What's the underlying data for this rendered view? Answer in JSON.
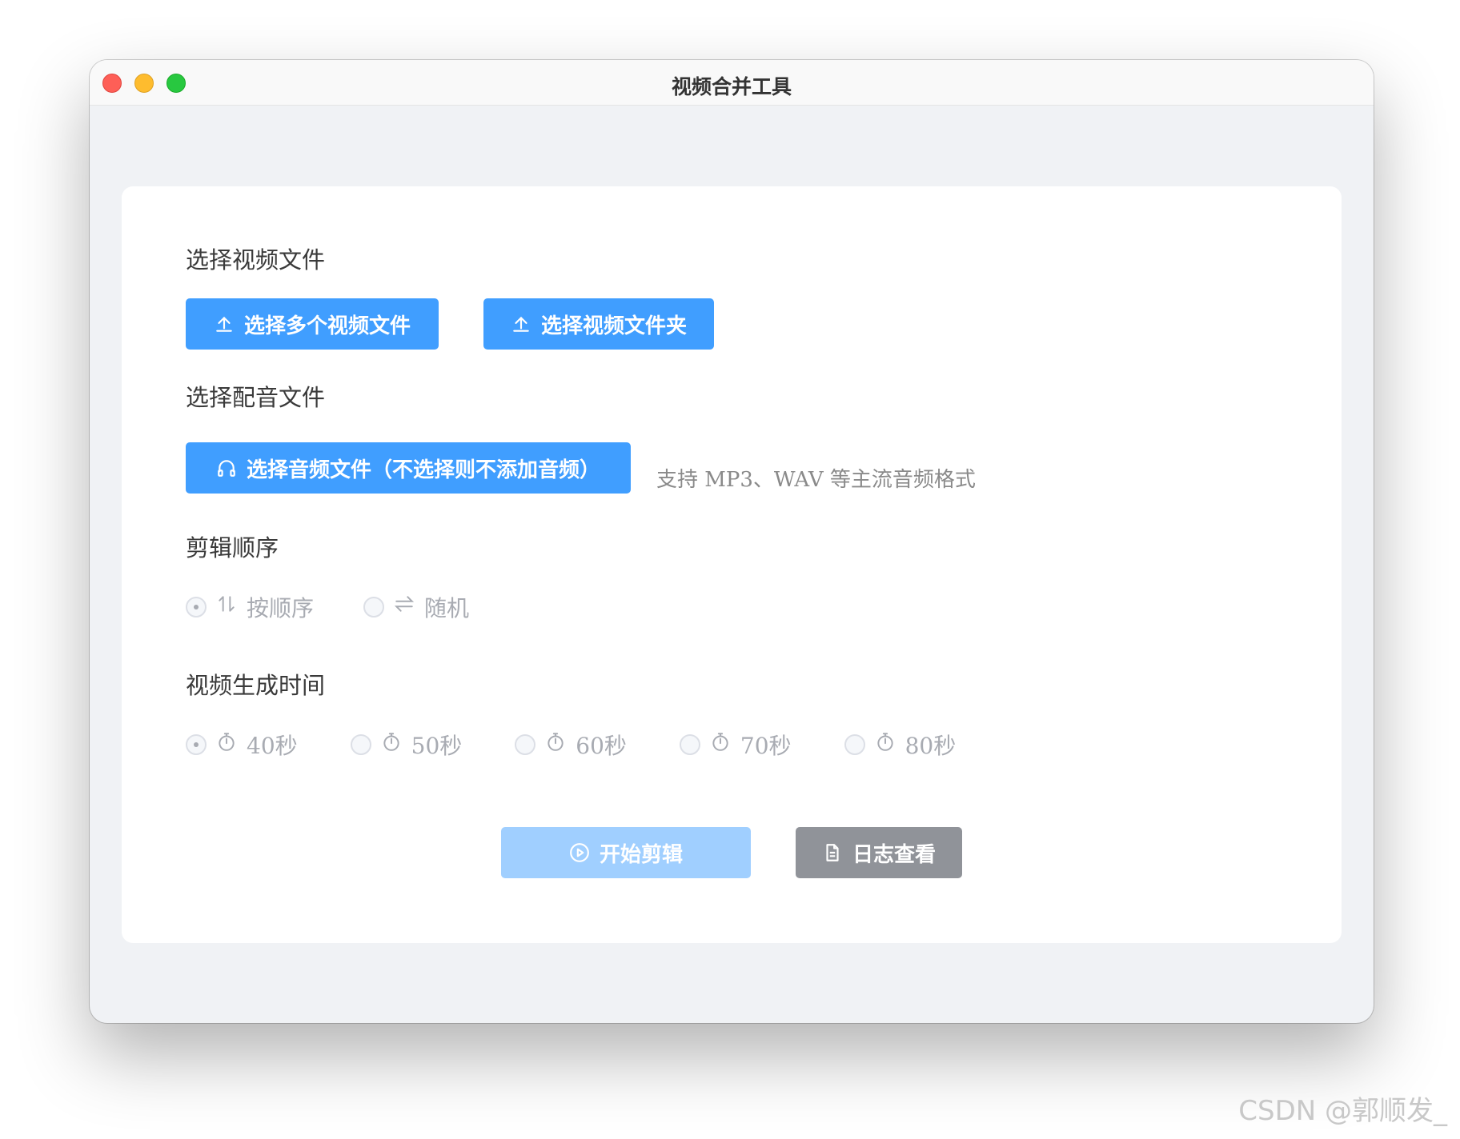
{
  "window": {
    "title": "视频合并工具"
  },
  "sections": {
    "video": {
      "label": "选择视频文件",
      "buttons": [
        {
          "label": "选择多个视频文件",
          "icon": "upload-icon"
        },
        {
          "label": "选择视频文件夹",
          "icon": "upload-icon"
        }
      ]
    },
    "audio": {
      "label": "选择配音文件",
      "button": {
        "label": "选择音频文件（不选择则不添加音频）",
        "icon": "headphones-icon"
      },
      "hint": "支持 MP3、WAV 等主流音频格式"
    },
    "order": {
      "label": "剪辑顺序",
      "options": [
        {
          "label": "按顺序",
          "icon": "sort-icon",
          "checked": true
        },
        {
          "label": "随机",
          "icon": "shuffle-icon",
          "checked": false
        }
      ]
    },
    "duration": {
      "label": "视频生成时间",
      "options": [
        {
          "label": "40秒",
          "icon": "timer-icon",
          "checked": true
        },
        {
          "label": "50秒",
          "icon": "timer-icon",
          "checked": false
        },
        {
          "label": "60秒",
          "icon": "timer-icon",
          "checked": false
        },
        {
          "label": "70秒",
          "icon": "timer-icon",
          "checked": false
        },
        {
          "label": "80秒",
          "icon": "timer-icon",
          "checked": false
        }
      ]
    }
  },
  "actions": {
    "start": {
      "label": "开始剪辑",
      "icon": "play-circle-icon"
    },
    "log": {
      "label": "日志查看",
      "icon": "document-icon"
    }
  },
  "watermark": "CSDN @郭顺发_",
  "colors": {
    "primary": "#409eff",
    "disabled": "#a0cfff",
    "gray": "#909399",
    "window_bg": "#f0f2f5"
  }
}
